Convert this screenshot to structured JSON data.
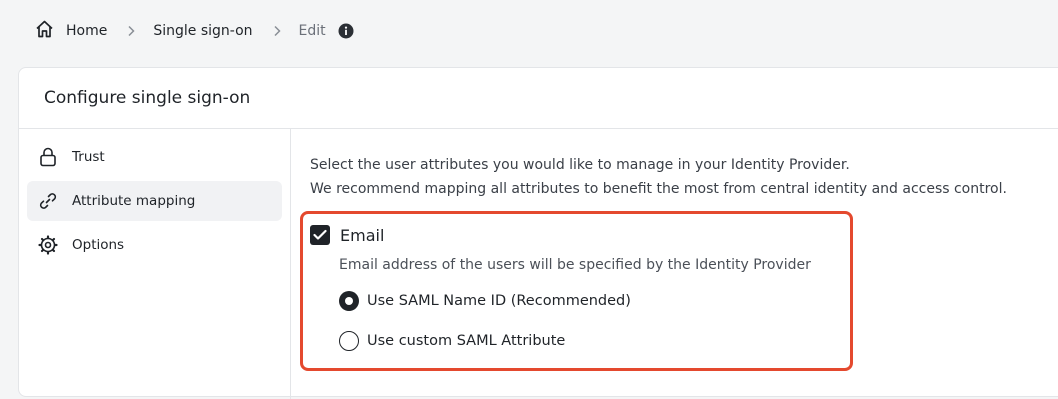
{
  "breadcrumb": {
    "home": "Home",
    "items": [
      "Single sign-on"
    ],
    "current": "Edit"
  },
  "card": {
    "title": "Configure single sign-on"
  },
  "sidebar": {
    "items": [
      {
        "label": "Trust",
        "icon": "lock-icon",
        "active": false
      },
      {
        "label": "Attribute mapping",
        "icon": "link-icon",
        "active": true
      },
      {
        "label": "Options",
        "icon": "gear-icon",
        "active": false
      }
    ]
  },
  "main": {
    "intro_line1": "Select the user attributes you would like to manage in your Identity Provider.",
    "intro_line2": "We recommend mapping all attributes to benefit the most from central identity and access control.",
    "email": {
      "label": "Email",
      "checked": true,
      "description": "Email address of the users will be specified by the Identity Provider",
      "options": [
        {
          "label": "Use SAML Name ID (Recommended)",
          "selected": true
        },
        {
          "label": "Use custom SAML Attribute",
          "selected": false
        }
      ]
    }
  },
  "colors": {
    "highlight": "#e4492e",
    "text": "#1f2328"
  }
}
